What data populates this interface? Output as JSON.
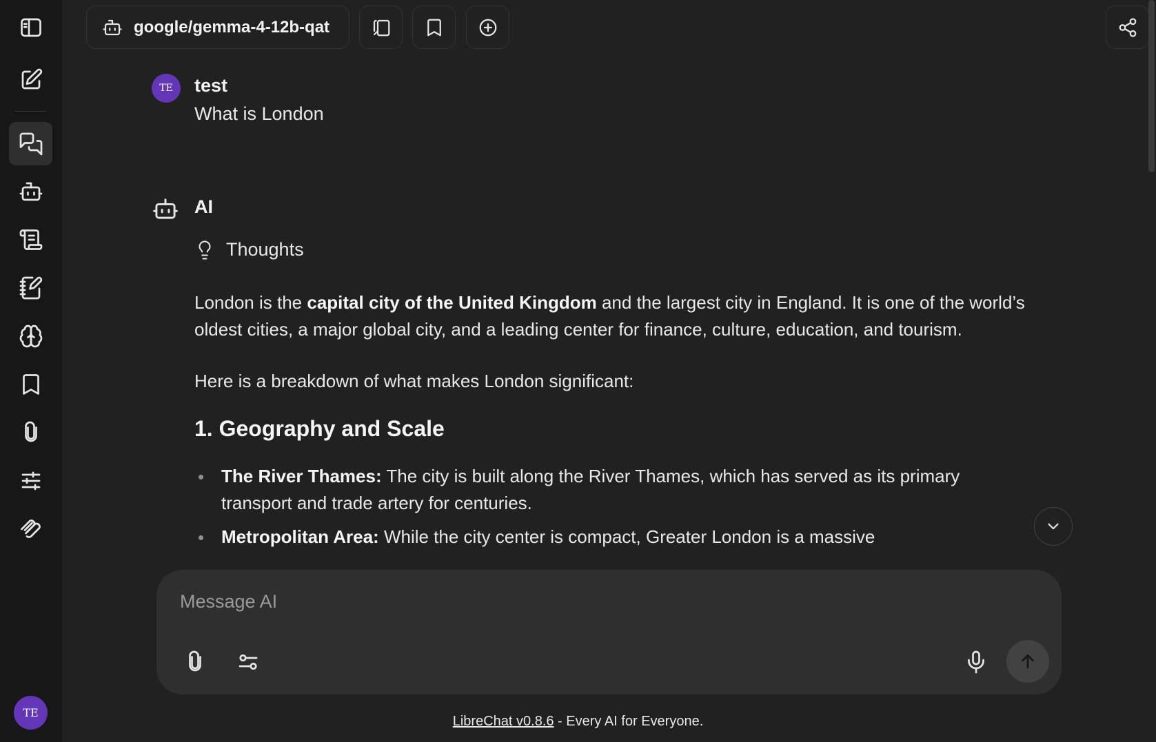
{
  "header": {
    "model_name": "google/gemma-4-12b-qat"
  },
  "user_message": {
    "avatar_initials": "TE",
    "author": "test",
    "text": "What is London"
  },
  "ai_message": {
    "author": "AI",
    "thoughts_label": "Thoughts",
    "intro_before_bold": "London is the ",
    "intro_bold": "capital city of the United Kingdom",
    "intro_after_bold": " and the largest city in England. It is one of the world’s oldest cities, a major global city, and a leading center for finance, culture, education, and tourism.",
    "breakdown": "Here is a breakdown of what makes London significant:",
    "section_heading": "1. Geography and Scale",
    "bullets": [
      {
        "bold": "The River Thames:",
        "text": " The city is built along the River Thames, which has served as its primary transport and trade artery for centuries."
      },
      {
        "bold": "Metropolitan Area:",
        "text": " While the city center is compact, Greater London is a massive"
      }
    ]
  },
  "composer": {
    "placeholder": "Message AI"
  },
  "footer": {
    "link_text": "LibreChat v0.8.6",
    "tagline": " - Every AI for Everyone."
  },
  "sidebar": {
    "user_initials": "TE"
  }
}
